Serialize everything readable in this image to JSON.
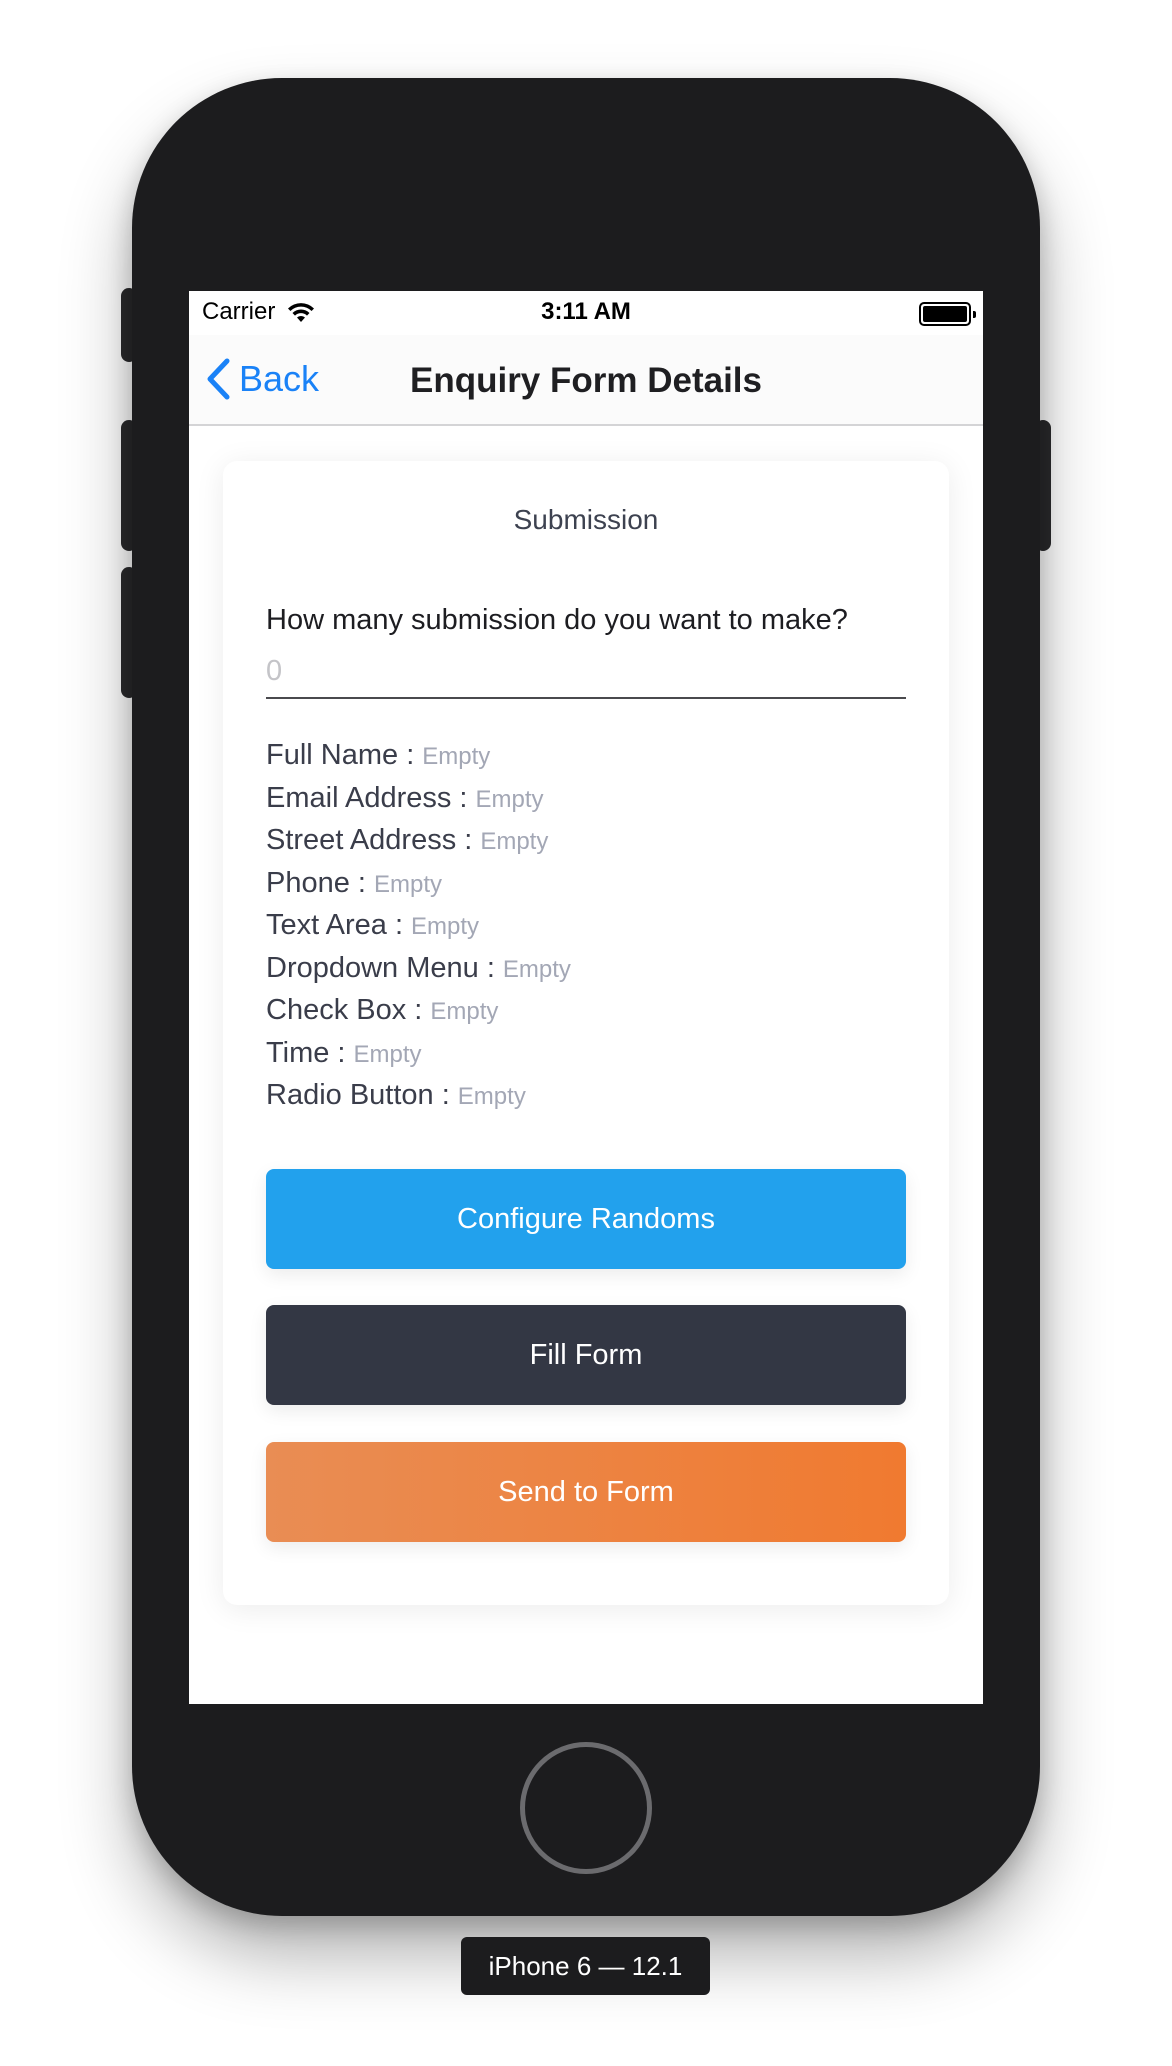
{
  "status_bar": {
    "carrier": "Carrier",
    "time": "3:11 AM"
  },
  "nav": {
    "back_label": "Back",
    "title": "Enquiry Form Details"
  },
  "card": {
    "title": "Submission",
    "question": "How many submission do you want to make?",
    "input_placeholder": "0",
    "fields": [
      {
        "label": "Full Name :",
        "value": "Empty"
      },
      {
        "label": "Email Address :",
        "value": "Empty"
      },
      {
        "label": "Street Address :",
        "value": "Empty"
      },
      {
        "label": "Phone :",
        "value": "Empty"
      },
      {
        "label": "Text Area :",
        "value": "Empty"
      },
      {
        "label": "Dropdown Menu :",
        "value": "Empty"
      },
      {
        "label": "Check Box :",
        "value": "Empty"
      },
      {
        "label": "Time :",
        "value": "Empty"
      },
      {
        "label": "Radio Button :",
        "value": "Empty"
      }
    ],
    "buttons": {
      "configure": "Configure Randoms",
      "fill": "Fill Form",
      "send": "Send to Form"
    }
  },
  "device_label": "iPhone 6 — 12.1",
  "colors": {
    "accent_blue": "#1a82f7",
    "configure_button": "#22a1ed",
    "fill_button": "#333744",
    "send_button_start": "#e98d54",
    "send_button_end": "#f07a30"
  },
  "icons": [
    "wifi-icon",
    "battery-icon",
    "back-chevron-icon"
  ]
}
